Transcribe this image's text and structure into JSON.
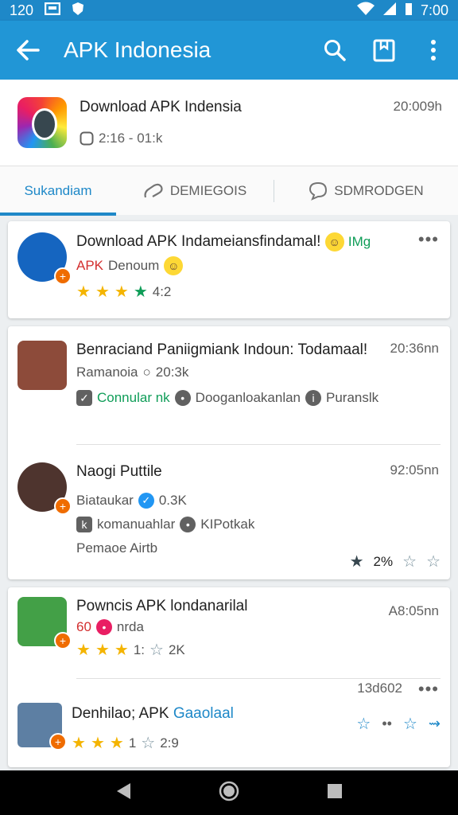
{
  "status_bar": {
    "time_left": "120",
    "time_right": "7:00"
  },
  "app_bar": {
    "title": "APK Indonesia"
  },
  "top_item": {
    "title": "Download APK Indensia",
    "subtitle": "2:16 - 01:k",
    "time": "20:009h"
  },
  "tabs": [
    {
      "label": "Sukandiam",
      "active": true
    },
    {
      "label": "DEMIEGOIS",
      "active": false
    },
    {
      "label": "SDMRODGEN",
      "active": false
    }
  ],
  "card1": {
    "title": "Download APK Indameiansfindamal!",
    "tag": "IMg",
    "apk": "APK",
    "author": "Denoum",
    "rating": "4:2"
  },
  "card2": {
    "item1": {
      "title": "Benraciand Paniigmiank Indoun: Todamaal!",
      "time": "20:36nn",
      "meta": "Ramanoia",
      "count": "20:3k",
      "chip1": "Connular nk",
      "chip2": "Dooganloakanlan",
      "chip3": "Puranslk"
    },
    "item2": {
      "title": "Naogi Puttile",
      "time": "92:05nn",
      "meta": "Biataukar",
      "count": "0.3K",
      "chip1": "komanuahlar",
      "chip2": "KIPotkak",
      "footer": "Pemaoe Airtb",
      "rating": "2%"
    }
  },
  "card3": {
    "item1": {
      "title": "Powncis APK londanarilal",
      "time": "A8:05nn",
      "meta_a": "60",
      "meta_b": "nrda",
      "rating_a": "1:",
      "rating_b": "2K"
    },
    "item2": {
      "title_a": "Denhilao; APK",
      "title_b": "Gaaolaal",
      "time": "13d602",
      "rating_a": "1",
      "rating_b": "2:9"
    }
  }
}
